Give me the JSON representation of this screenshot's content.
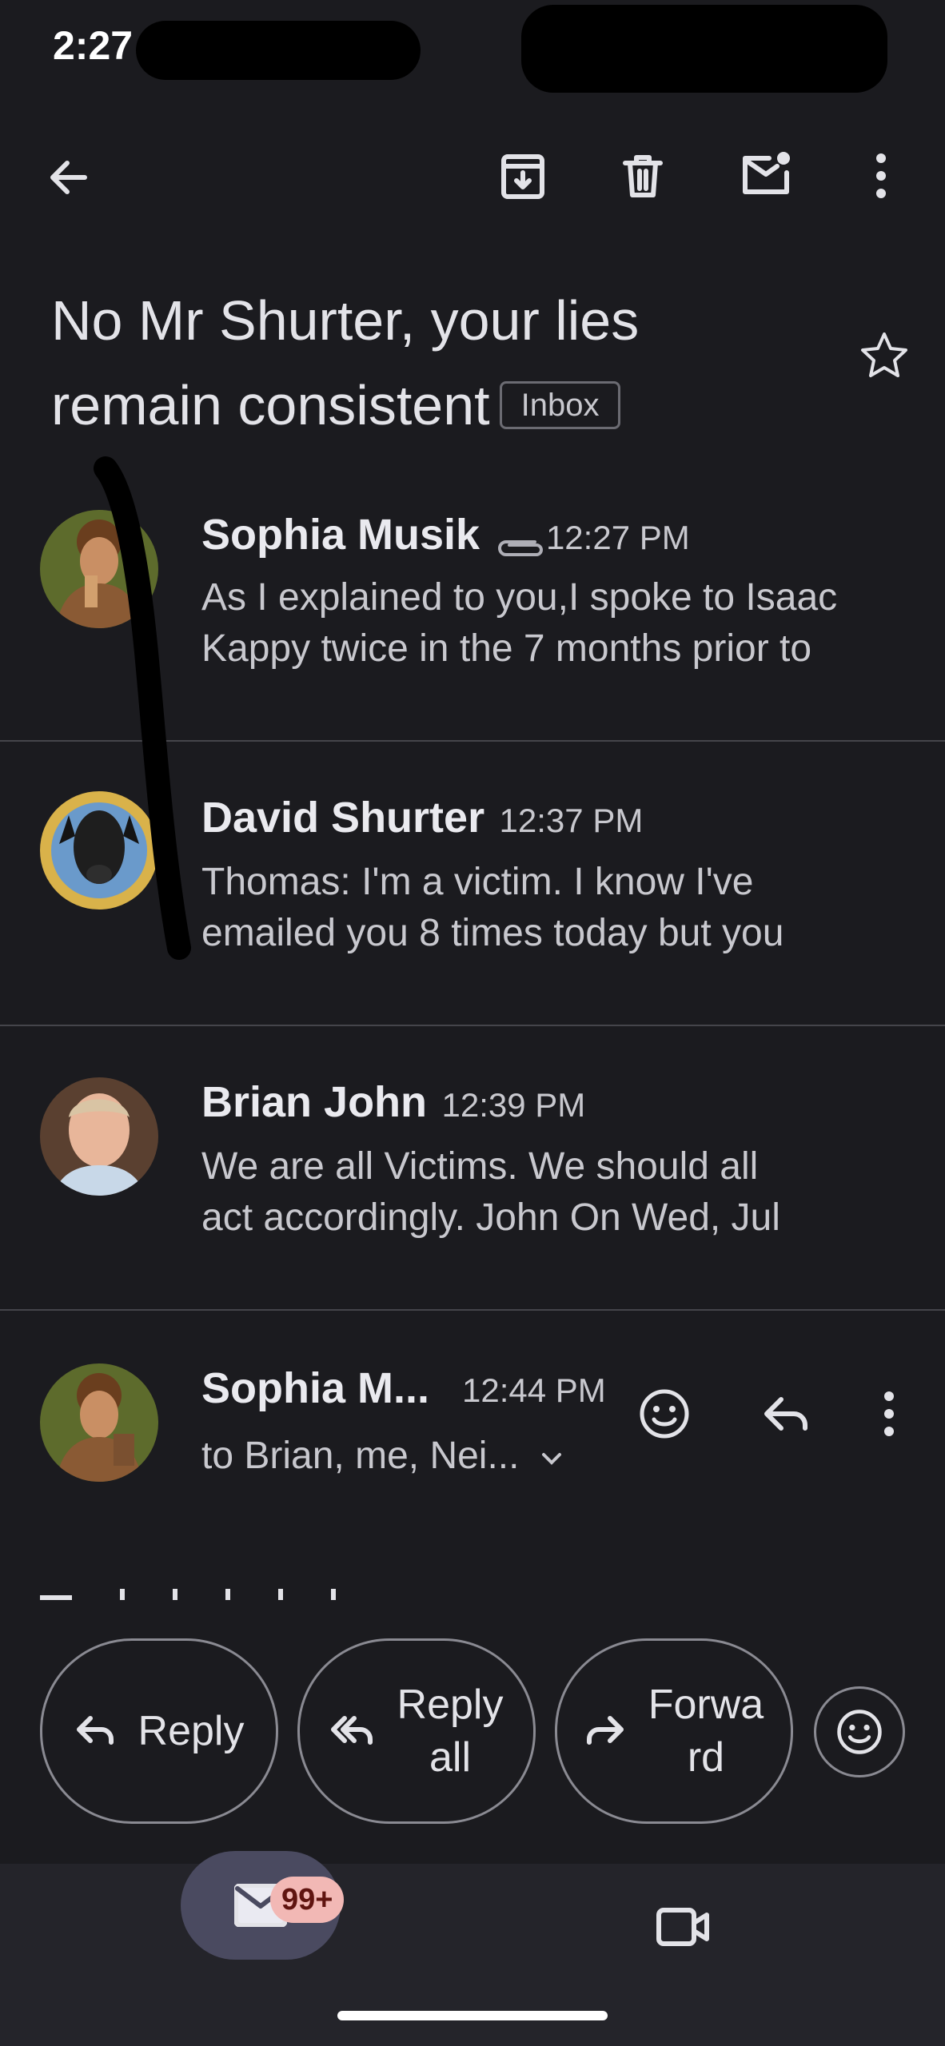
{
  "status_bar": {
    "time": "2:27"
  },
  "toolbar": {
    "icons": [
      "back-arrow-icon",
      "archive-icon",
      "trash-icon",
      "mark-unread-icon",
      "more-vert-icon"
    ]
  },
  "subject": {
    "line1": "No Mr Shurter, your lies",
    "line2": "remain consistent",
    "label": "Inbox"
  },
  "messages": [
    {
      "sender": "Sophia Musik",
      "time": "12:27 PM",
      "has_attachment": true,
      "snippet_line1": "As I explained to you,I spoke to Isaac",
      "snippet_line2": "Kappy twice in the 7 months prior to"
    },
    {
      "sender": "David Shurter",
      "time": "12:37 PM",
      "snippet_line1": "Thomas: I'm a victim. I know I've",
      "snippet_line2": "emailed you 8 times today but you"
    },
    {
      "sender": "Brian John",
      "time": "12:39 PM",
      "snippet_line1": "We are all Victims. We should all",
      "snippet_line2": "act accordingly. John On Wed, Jul"
    }
  ],
  "expanded_message": {
    "sender": "Sophia M...",
    "time": "12:44 PM",
    "recipients": "to Brian, me, Nei..."
  },
  "actions": {
    "reply": "Reply",
    "reply_all_line1": "Reply",
    "reply_all_line2": "all",
    "forward_line1": "Forwa",
    "forward_line2": "rd"
  },
  "bottom_nav": {
    "mail_badge": "99+",
    "colors": {
      "badge_bg": "#f2b8b5",
      "active_pill": "#4a4a60"
    }
  }
}
